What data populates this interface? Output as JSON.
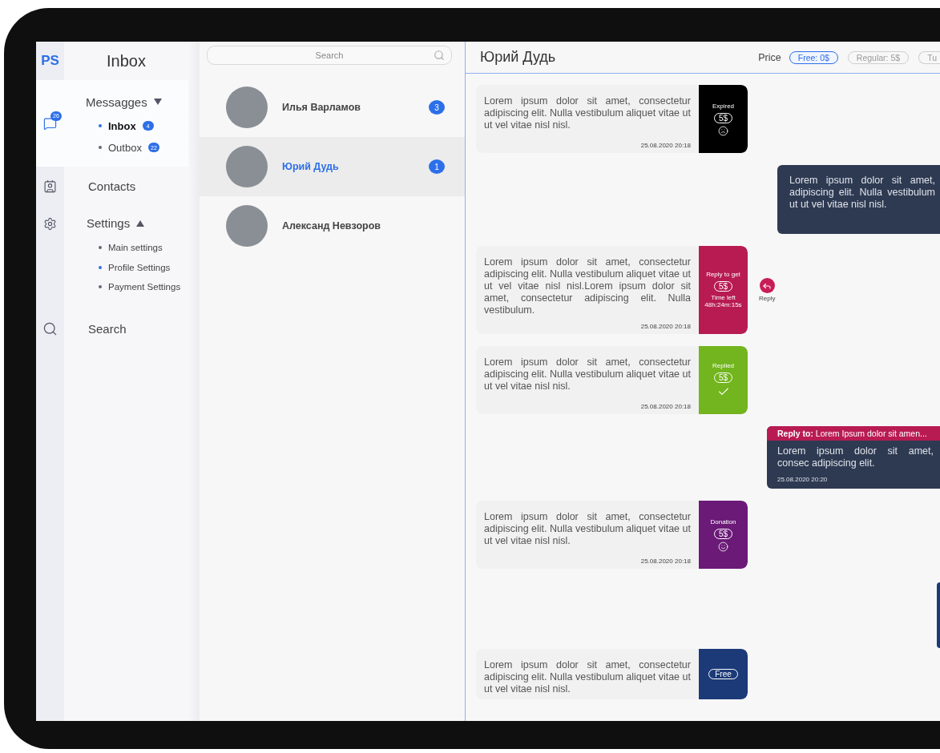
{
  "brand": "PS",
  "sidebar": {
    "title": "Inbox",
    "rail_badge": "26",
    "items": [
      {
        "label": "Messagges",
        "selected": true,
        "expanded": true,
        "caret_up": false,
        "children": [
          {
            "label": "Inbox",
            "badge": "4",
            "selected": true
          },
          {
            "label": "Outbox",
            "badge": "22",
            "selected": false
          }
        ]
      },
      {
        "label": "Contacts",
        "selected": false
      },
      {
        "label": "Settings",
        "selected": false,
        "expanded": true,
        "caret_up": true,
        "children": [
          {
            "label": "Main settings",
            "selected": false
          },
          {
            "label": "Profile Settings",
            "selected": true
          },
          {
            "label": "Payment Settings",
            "selected": false
          }
        ]
      },
      {
        "label": "Search",
        "selected": false
      }
    ]
  },
  "contacts": {
    "search": {
      "placeholder": "Search"
    },
    "items": [
      {
        "name": "Илья Варламов",
        "badge": "3",
        "selected": false
      },
      {
        "name": "Юрий Дудь",
        "badge": "1",
        "selected": true
      },
      {
        "name": "Александ Невзоров",
        "selected": false
      }
    ]
  },
  "chat": {
    "title": "Юрий Дудь",
    "price_label": "Price",
    "price_options": [
      {
        "label": "Free: 0$",
        "selected": true
      },
      {
        "label": "Regular: 5$",
        "selected": false
      },
      {
        "label": "Tu",
        "selected": false
      }
    ],
    "messages": [
      {
        "kind": "incoming",
        "text": "Lorem ipsum dolor sit amet, consectetur adipiscing elit. Nulla vestibulum aliquet vitae ut ut vel vitae nisl nisl.",
        "time": "25.08.2020  20:18",
        "tag": {
          "kind": "expired",
          "color": "#000000",
          "label": "Expired",
          "price": "5$"
        }
      },
      {
        "kind": "outgoing",
        "text": "Lorem ipsum dolor sit amet, adipiscing elit. Nulla vestibulum ut ut vel vitae nisl nisl."
      },
      {
        "kind": "incoming",
        "text": "Lorem ipsum dolor sit amet, consectetur adipiscing elit. Nulla vestibulum aliquet vitae ut ut vel vitae nisl nisl.Lorem ipsum dolor sit amet, consectetur adipiscing elit. Nulla vestibulum.",
        "time": "25.08.2020  20:18",
        "tag": {
          "kind": "reply_to_get",
          "color": "#b81b52",
          "label": "Reply to get",
          "price": "5$",
          "timer_label": "Time left",
          "timer": "48h:24m:15s"
        },
        "reply_action": {
          "label": "Reply"
        }
      },
      {
        "kind": "incoming",
        "text": "Lorem ipsum dolor sit amet, consectetur adipiscing elit. Nulla vestibulum aliquet vitae ut ut vel vitae nisl nisl.",
        "time": "25.08.2020  20:18",
        "tag": {
          "kind": "replied",
          "color": "#72b51e",
          "label": "Replied",
          "price": "5$"
        }
      },
      {
        "kind": "outgoing",
        "reply_to": "**Reply to:**  Lorem Ipsum dolor sit amen...",
        "text": "Lorem ipsum dolor sit amet, consec adipiscing elit.",
        "time": "25.08.2020  20:20"
      },
      {
        "kind": "incoming",
        "text": "Lorem ipsum dolor sit amet, consectetur adipiscing elit. Nulla vestibulum aliquet vitae ut ut vel vitae nisl nisl.",
        "time": "25.08.2020  20:18",
        "tag": {
          "kind": "donation",
          "color": "#6b1a78",
          "label": "Donation",
          "price": "5$"
        }
      },
      {
        "kind": "outgoing_edge"
      },
      {
        "kind": "incoming",
        "text": "Lorem ipsum dolor sit amet, consectetur adipiscing elit. Nulla vestibulum aliquet vitae ut ut vel vitae nisl nisl.",
        "tag": {
          "kind": "free",
          "color": "#1c3a78",
          "price": "Free"
        }
      }
    ]
  }
}
